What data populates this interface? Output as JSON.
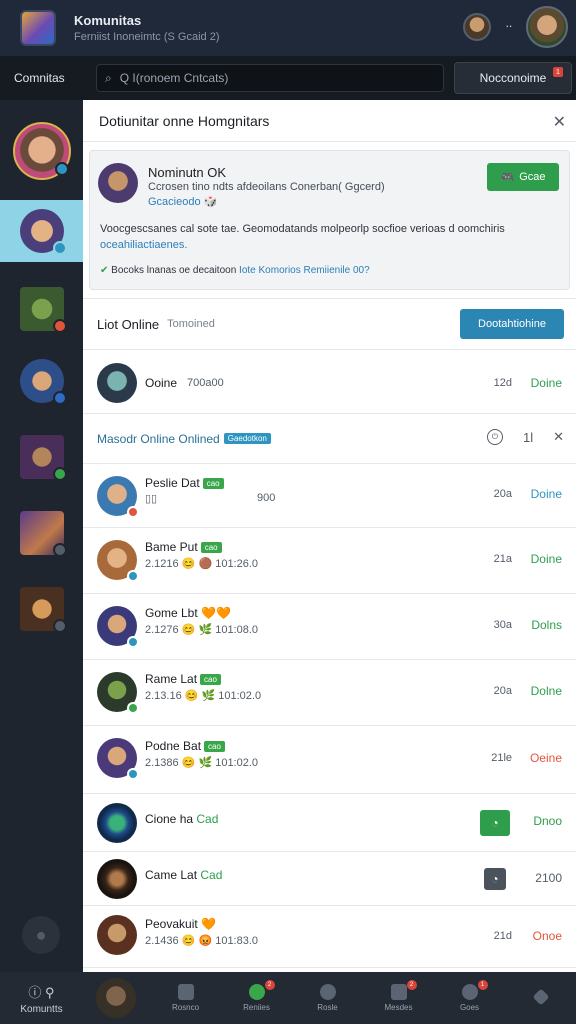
{
  "topbar": {
    "title": "Komunitas",
    "subtitle": "Ferniist Inoneimtc (S Gcaid 2)",
    "eye_icon": "eye-icon"
  },
  "searchrow": {
    "label": "Comnitas",
    "search_placeholder": "Q  I(ronoem Cntcats)",
    "notif_label": "Nocconoime",
    "notif_count": "1"
  },
  "panel": {
    "title": "Dotiunitar onne Homgnitars",
    "close_icon": "close-icon"
  },
  "card": {
    "name": "Nominutn OK",
    "meta": "Ccrosen tino ndts afdeoilans Conerban( Ggcerd)",
    "link": "Gcacieodo",
    "emoji": "🎲",
    "button": "Gcae",
    "desc_a": "Voocgescsanes cal sote tae. Geomodatands molpeorlp socfioe verioas d oomchiris",
    "desc_b": "oceahiliactiaenes.",
    "foot_text": "Bocoks lnanas oe decaitoon",
    "foot_link": "Iote Komorios Remiienile 00?"
  },
  "list_header": {
    "title": "Liot Online",
    "sub": "Tomoined",
    "button": "Dootahtiohine"
  },
  "row1": {
    "name": "Ooine",
    "num": "700a00",
    "time": "12d",
    "status": "Doine"
  },
  "section": {
    "title": "Masodr Online Onlined",
    "tag": "Gaedotkon",
    "ctrl_circle": "⏻",
    "ctrl_1": "1l",
    "ctrl_close": "✕"
  },
  "rows": [
    {
      "name": "Peslie Dat",
      "tag": "cao",
      "sub": "▯▯",
      "num": "900",
      "time": "20a",
      "status": "Doine",
      "status_color": "#2d95c0"
    },
    {
      "name": "Bame Put",
      "tag": "cao",
      "sub": "2.1216 😊 🟤 101:26.0",
      "time": "21a",
      "status": "Doine",
      "status_color": "#2e9e4c"
    },
    {
      "name": "Gome Lbt 🧡🧡",
      "tag": "",
      "sub": "2.1276 😊 🌿 101:08.0",
      "time": "30a",
      "status": "Dolns",
      "status_color": "#2e9e4c"
    },
    {
      "name": "Rame Lat",
      "tag": "cao",
      "sub": "2.13.16 😊 🌿 101:02.0",
      "time": "20a",
      "status": "Dolne",
      "status_color": "#2e9e4c"
    },
    {
      "name": "Podne Bat",
      "tag": "cao",
      "sub": "2.1386 😊 🌿 101:02.0",
      "time": "21le",
      "status": "Oeine",
      "status_color": "#e2553a"
    }
  ],
  "row_green": {
    "name": "Cione ha",
    "tag": "Cad",
    "status": "Dnoo"
  },
  "row_gray": {
    "name": "Came Lat",
    "tag": "Cad",
    "status": "2100"
  },
  "row_last": {
    "name": "Peovakuit 🧡",
    "sub": "2.1436 😊 😡 101:83.0",
    "time": "21d",
    "status": "Onoe"
  },
  "bottom": {
    "home_label": "Komuntts",
    "tabs": [
      {
        "label": "Rosnco",
        "badge": ""
      },
      {
        "label": "Reniies",
        "badge": "2"
      },
      {
        "label": "Rosle",
        "badge": ""
      },
      {
        "label": "Mesdes",
        "badge": "2"
      },
      {
        "label": "Goes",
        "badge": "1"
      },
      {
        "label": "",
        "badge": ""
      }
    ]
  },
  "colors": {
    "accent_green": "#2e9e4c",
    "accent_blue": "#2b86b3",
    "accent_red": "#e2553a",
    "sidebar_active": "#8fd3e6"
  }
}
